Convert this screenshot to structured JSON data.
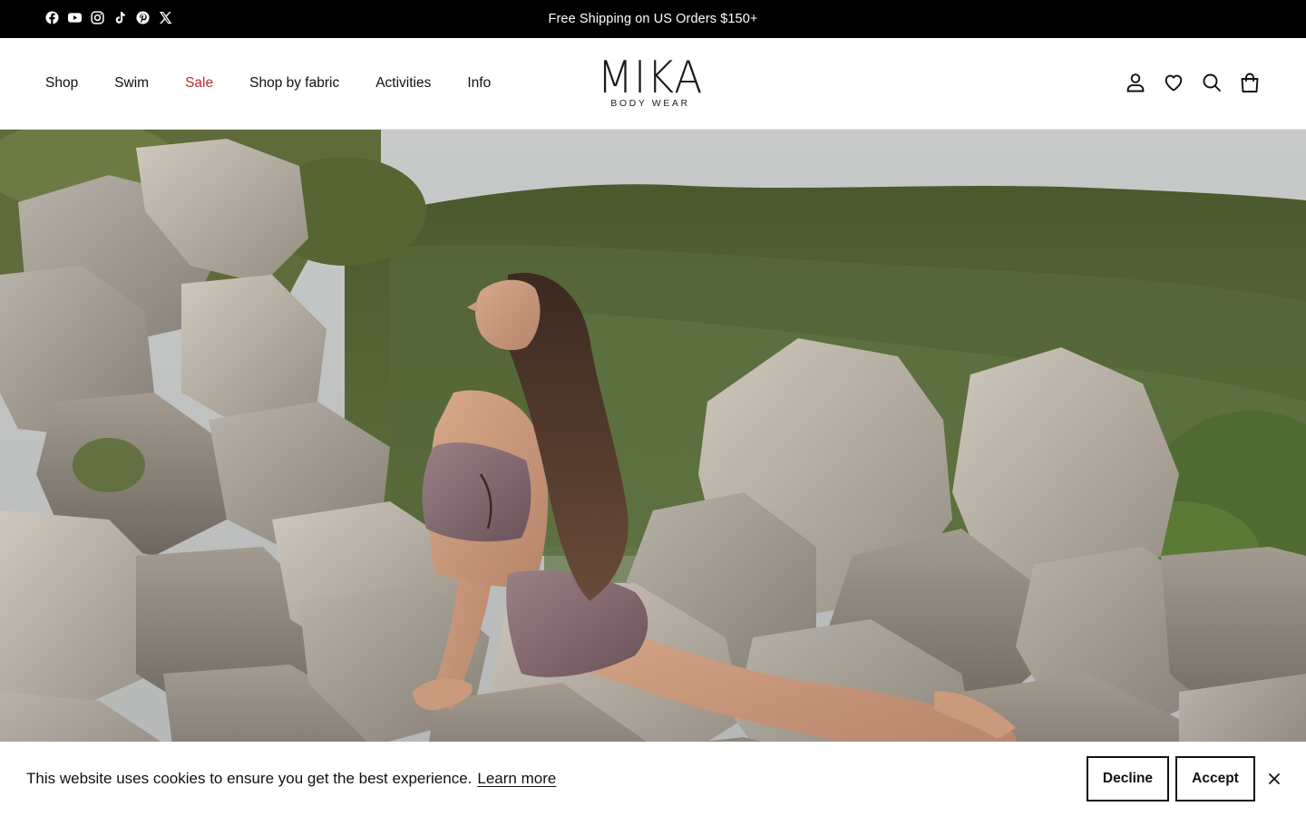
{
  "announcement": {
    "text": "Free Shipping on US Orders $150+",
    "social_icons": [
      "facebook-icon",
      "youtube-icon",
      "instagram-icon",
      "tiktok-icon",
      "pinterest-icon",
      "x-icon"
    ]
  },
  "header": {
    "nav": {
      "shop": "Shop",
      "swim": "Swim",
      "sale": "Sale",
      "shop_by_fabric": "Shop by fabric",
      "activities": "Activities",
      "info": "Info"
    },
    "logo": {
      "main": "MIKA",
      "sub": "BODY WEAR"
    },
    "icons": [
      "account-icon",
      "wishlist-heart-icon",
      "search-icon",
      "cart-bag-icon"
    ],
    "sale_color": "#b8312f"
  },
  "cookie_banner": {
    "message": "This website uses cookies to ensure you get the best experience.",
    "learn_more": "Learn more",
    "decline": "Decline",
    "accept": "Accept"
  },
  "colors": {
    "announcement_bg": "#000000",
    "text": "#111111",
    "sale": "#b8312f"
  }
}
